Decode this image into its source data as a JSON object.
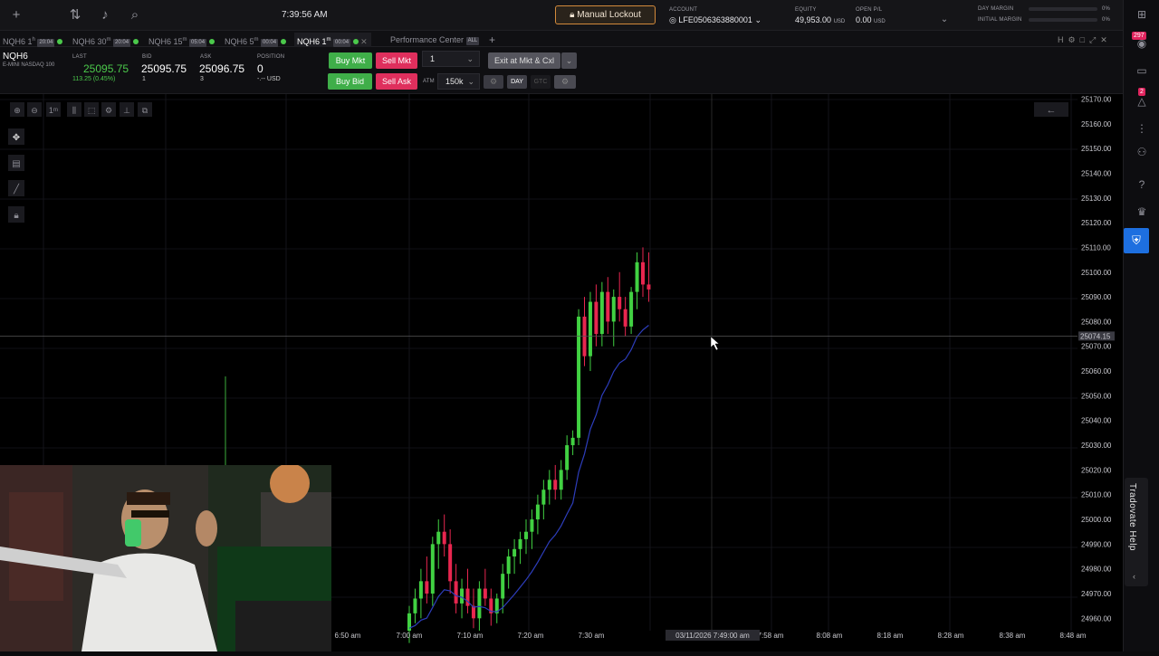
{
  "topbar": {
    "clock": "7:39:56 AM",
    "lockout_label": "Manual Lockout",
    "account_label": "ACCOUNT",
    "account_value": "LFE0506363880001",
    "equity_label": "EQUITY",
    "equity_value": "49,953.00",
    "equity_unit": "USD",
    "openpl_label": "OPEN P/L",
    "openpl_value": "0.00",
    "openpl_unit": "USD",
    "day_margin_label": "DAY MARGIN",
    "day_margin_value": "0%",
    "initial_margin_label": "INITIAL MARGIN",
    "initial_margin_value": "0%",
    "icons": [
      "plus-icon",
      "transfer-icon",
      "bell-icon",
      "search-icon"
    ]
  },
  "tabs": [
    {
      "label": "NQH6 1",
      "sup": "h",
      "time": "20:04",
      "active": false
    },
    {
      "label": "NQH6 30",
      "sup": "m",
      "time": "20:04",
      "active": false
    },
    {
      "label": "NQH6 15",
      "sup": "m",
      "time": "05:04",
      "active": false
    },
    {
      "label": "NQH6 5",
      "sup": "m",
      "time": "00:04",
      "active": false
    },
    {
      "label": "NQH6 1",
      "sup": "m",
      "time": "00:04",
      "active": true
    },
    {
      "label": "Performance Center",
      "sup": "",
      "time": "ALL",
      "active": false
    }
  ],
  "quote": {
    "symbol": "NQH6",
    "desc": "E-MINI NASDAQ 100",
    "last_label": "LAST",
    "last": "25095.75",
    "change": "113.25 (0.45%)",
    "bid_label": "BID",
    "bid": "25095.75",
    "bid_size": "1",
    "ask_label": "ASK",
    "ask": "25096.75",
    "ask_size": "3",
    "position_label": "POSITION",
    "position": "0",
    "position_sub": "-.-- USD"
  },
  "order": {
    "buy_mkt": "Buy Mkt",
    "sell_mkt": "Sell Mkt",
    "buy_bid": "Buy Bid",
    "sell_ask": "Sell Ask",
    "qty": "1",
    "exit": "Exit at Mkt & Cxl",
    "atm_label": "ATM",
    "atm_value": "150k",
    "day": "DAY",
    "gtc": "GTC"
  },
  "chart_data": {
    "type": "candlestick",
    "ylim": [
      24955,
      25172
    ],
    "y_ticks": [
      "25170.00",
      "25160.00",
      "25150.00",
      "25140.00",
      "25130.00",
      "25120.00",
      "25110.00",
      "25100.00",
      "25090.00",
      "25080.00",
      "25070.00",
      "25060.00",
      "25050.00",
      "25040.00",
      "25030.00",
      "25020.00",
      "25010.00",
      "25000.00",
      "24990.00",
      "24980.00",
      "24970.00",
      "24960.00"
    ],
    "x_ticks": [
      "6:50 am",
      "7:00 am",
      "7:10 am",
      "7:20 am",
      "7:30 am",
      "7:58 am",
      "8:08 am",
      "8:18 am",
      "8:28 am",
      "8:38 am",
      "8:48 am"
    ],
    "crosshair_price": "25074.15",
    "crosshair_time": "03/11/2026 7:49:00 am",
    "timeframe": "1m",
    "candles": [
      [
        24955,
        24965,
        24950,
        24962
      ],
      [
        24962,
        24972,
        24958,
        24968
      ],
      [
        24968,
        24980,
        24960,
        24975
      ],
      [
        24975,
        24985,
        24966,
        24970
      ],
      [
        24970,
        24993,
        24965,
        24990
      ],
      [
        24990,
        25000,
        24980,
        24995
      ],
      [
        24995,
        25002,
        24985,
        24990
      ],
      [
        24990,
        24996,
        24970,
        24975
      ],
      [
        24975,
        24982,
        24962,
        24966
      ],
      [
        24966,
        24976,
        24960,
        24972
      ],
      [
        24972,
        24980,
        24962,
        24965
      ],
      [
        24965,
        24972,
        24956,
        24960
      ],
      [
        24960,
        24975,
        24955,
        24972
      ],
      [
        24972,
        24980,
        24965,
        24968
      ],
      [
        24968,
        24972,
        24957,
        24962
      ],
      [
        24962,
        24970,
        24958,
        24968
      ],
      [
        24968,
        24982,
        24962,
        24978
      ],
      [
        24978,
        24988,
        24972,
        24985
      ],
      [
        24985,
        24992,
        24978,
        24988
      ],
      [
        24988,
        24995,
        24982,
        24992
      ],
      [
        24992,
        25000,
        24986,
        24995
      ],
      [
        24995,
        25004,
        24988,
        25000
      ],
      [
        25000,
        25010,
        24994,
        25006
      ],
      [
        25006,
        25016,
        25000,
        25012
      ],
      [
        25012,
        25020,
        25006,
        25016
      ],
      [
        25016,
        25022,
        25008,
        25012
      ],
      [
        25012,
        25024,
        25008,
        25020
      ],
      [
        25020,
        25034,
        25016,
        25030
      ],
      [
        25030,
        25036,
        25026,
        25033
      ],
      [
        25033,
        25085,
        25030,
        25082
      ],
      [
        25082,
        25090,
        25062,
        25066
      ],
      [
        25066,
        25092,
        25060,
        25088
      ],
      [
        25088,
        25095,
        25070,
        25075
      ],
      [
        25075,
        25096,
        25070,
        25092
      ],
      [
        25092,
        25098,
        25075,
        25080
      ],
      [
        25080,
        25093,
        25070,
        25090
      ],
      [
        25090,
        25100,
        25080,
        25085
      ],
      [
        25085,
        25090,
        25074,
        25078
      ],
      [
        25078,
        25094,
        25075,
        25092
      ],
      [
        25092,
        25108,
        25085,
        25104
      ],
      [
        25104,
        25110,
        25090,
        25095
      ],
      [
        25095,
        25108,
        25088,
        25093
      ]
    ]
  },
  "toolbar_icons": [
    "zoom-in-icon",
    "zoom-out-icon",
    "timeframe-icon",
    "candle-type-icon",
    "select-icon",
    "settings-icon",
    "indicators-icon",
    "layout-icon"
  ],
  "draw_tools": [
    "crosshair-tool-icon",
    "notes-icon",
    "line-tool-icon",
    "lock-icon"
  ],
  "right_panel": {
    "badge1": "297",
    "badge2": "2",
    "help_label": "Tradovate Help"
  }
}
